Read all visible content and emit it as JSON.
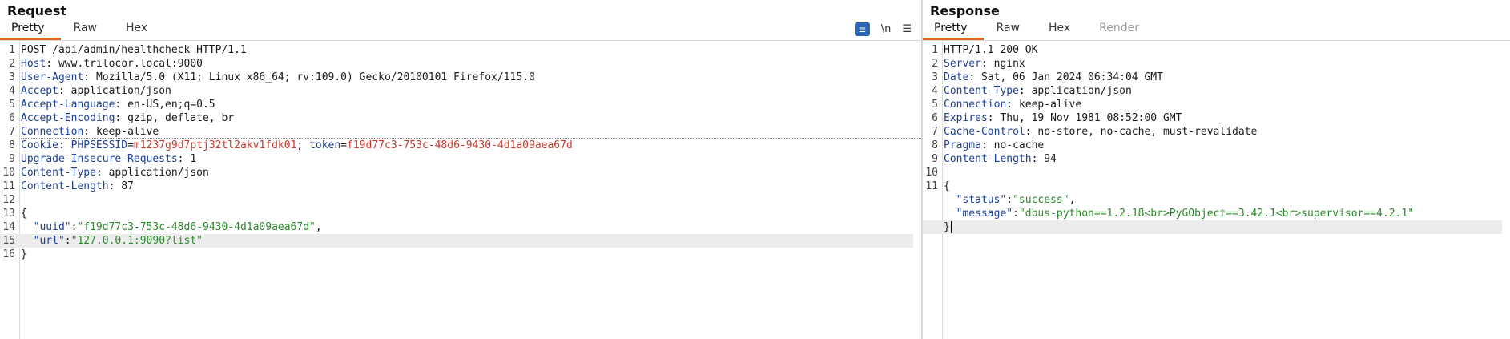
{
  "request": {
    "title": "Request",
    "tabs": [
      "Pretty",
      "Raw",
      "Hex"
    ],
    "tools": {
      "wrap_icon": "≡",
      "newline_label": "\\n",
      "menu_icon": "☰"
    },
    "line_numbers": [
      "1",
      "2",
      "3",
      "4",
      "5",
      "6",
      "7",
      "8",
      "9",
      "10",
      "11",
      "12",
      "13",
      "14",
      "15",
      "16"
    ],
    "request_line": "POST /api/admin/healthcheck HTTP/1.1",
    "headers": [
      {
        "name": "Host",
        "value": "www.trilocor.local:9000"
      },
      {
        "name": "User-Agent",
        "value": "Mozilla/5.0 (X11; Linux x86_64; rv:109.0) Gecko/20100101 Firefox/115.0"
      },
      {
        "name": "Accept",
        "value": "application/json"
      },
      {
        "name": "Accept-Language",
        "value": "en-US,en;q=0.5"
      },
      {
        "name": "Accept-Encoding",
        "value": "gzip, deflate, br"
      },
      {
        "name": "Connection",
        "value": "keep-alive"
      }
    ],
    "cookie": {
      "name": "Cookie",
      "phpsess_name": "PHPSESSID",
      "phpsess_value": "m1237g9d7ptj32tl2akv1fdk01",
      "token_name": "token",
      "token_value": "f19d77c3-753c-48d6-9430-4d1a09aea67d"
    },
    "headers2": [
      {
        "name": "Upgrade-Insecure-Requests",
        "value": "1"
      },
      {
        "name": "Content-Type",
        "value": "application/json"
      },
      {
        "name": "Content-Length",
        "value": "87"
      }
    ],
    "body": {
      "open": "{",
      "uuid_key": "\"uuid\"",
      "uuid_value": "\"f19d77c3-753c-48d6-9430-4d1a09aea67d\"",
      "url_key": "\"url\"",
      "url_value": "\"127.0.0.1:9090?list\"",
      "close": "}"
    }
  },
  "response": {
    "title": "Response",
    "tabs": [
      "Pretty",
      "Raw",
      "Hex",
      "Render"
    ],
    "line_numbers": [
      "1",
      "2",
      "3",
      "4",
      "5",
      "6",
      "7",
      "8",
      "9",
      "10",
      "11"
    ],
    "status_line": "HTTP/1.1 200 OK",
    "headers": [
      {
        "name": "Server",
        "value": "nginx"
      },
      {
        "name": "Date",
        "value": "Sat, 06 Jan 2024 06:34:04 GMT"
      },
      {
        "name": "Content-Type",
        "value": "application/json"
      },
      {
        "name": "Connection",
        "value": "keep-alive"
      },
      {
        "name": "Expires",
        "value": "Thu, 19 Nov 1981 08:52:00 GMT"
      },
      {
        "name": "Cache-Control",
        "value": "no-store, no-cache, must-revalidate"
      },
      {
        "name": "Pragma",
        "value": "no-cache"
      },
      {
        "name": "Content-Length",
        "value": "94"
      }
    ],
    "body": {
      "open": "{",
      "status_key": "\"status\"",
      "status_value": "\"success\"",
      "message_key": "\"message\"",
      "message_value": "\"dbus-python==1.2.18<br>PyGObject==3.42.1<br>supervisor==4.2.1\"",
      "close": "}"
    }
  },
  "colors": {
    "accent": "#e2651d",
    "header_name": "#1f3f93",
    "string": "#2a8a2a",
    "cookie_value": "#c43a2c",
    "wrap_button": "#2b66b9"
  }
}
